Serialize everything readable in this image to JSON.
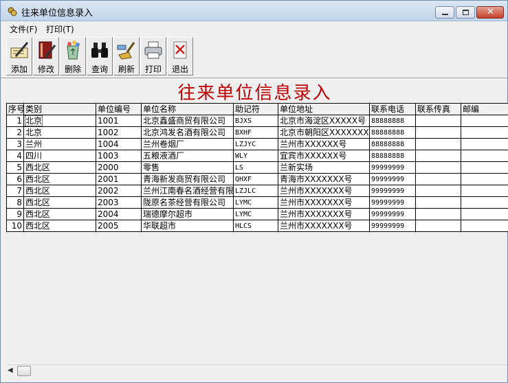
{
  "window": {
    "title": "往来单位信息录入"
  },
  "menu": [
    "文件(F)",
    "打印(T)"
  ],
  "toolbar": [
    {
      "label": "添加",
      "icon": "write-icon"
    },
    {
      "label": "修改",
      "icon": "book-edit-icon"
    },
    {
      "label": "删除",
      "icon": "recycle-bin-icon"
    },
    {
      "label": "查询",
      "icon": "binoculars-icon"
    },
    {
      "label": "刷新",
      "icon": "refresh-brush-icon"
    },
    {
      "label": "打印",
      "icon": "printer-icon"
    },
    {
      "label": "退出",
      "icon": "exit-icon"
    }
  ],
  "report_title": "往来单位信息录入",
  "table": {
    "columns": [
      "序号",
      "类别",
      "单位编号",
      "单位名称",
      "助记符",
      "单位地址",
      "联系电话",
      "联系传真",
      "邮编"
    ],
    "rows": [
      [
        "1",
        "北京",
        "1001",
        "北京鑫盛商贸有限公司",
        "BJXS",
        "北京市海淀区XXXXX号",
        "88888888",
        "",
        ""
      ],
      [
        "2",
        "北京",
        "1002",
        "北京鸿发名酒有限公司",
        "BXHF",
        "北京市朝阳区XXXXXXX号",
        "88888888",
        "",
        ""
      ],
      [
        "3",
        "兰州",
        "1004",
        "兰州卷烟厂",
        "LZJYC",
        "兰州市XXXXXX号",
        "88888888",
        "",
        ""
      ],
      [
        "4",
        "四川",
        "1003",
        "五粮液酒厂",
        "WLY",
        "宜宾市XXXXXX号",
        "88888888",
        "",
        ""
      ],
      [
        "5",
        "西北区",
        "2000",
        "零售",
        "LS",
        "兰新实场",
        "99999999",
        "",
        ""
      ],
      [
        "6",
        "西北区",
        "2001",
        "青海新发商贸有限公司",
        "QHXF",
        "青海市XXXXXXX号",
        "99999999",
        "",
        ""
      ],
      [
        "7",
        "西北区",
        "2002",
        "兰州江南春名酒经营有限",
        "LZJLC",
        "兰州市XXXXXXX号",
        "99999999",
        "",
        ""
      ],
      [
        "8",
        "西北区",
        "2003",
        "陇原名茶经营有限公司",
        "LYMC",
        "兰州市XXXXXXX号",
        "99999999",
        "",
        ""
      ],
      [
        "9",
        "西北区",
        "2004",
        "瑞德摩尔超市",
        "LYMC",
        "兰州市XXXXXXX号",
        "99999999",
        "",
        ""
      ],
      [
        "10",
        "西北区",
        "2005",
        "华联超市",
        "HLCS",
        "兰州市XXXXXXX号",
        "99999999",
        "",
        ""
      ]
    ]
  }
}
